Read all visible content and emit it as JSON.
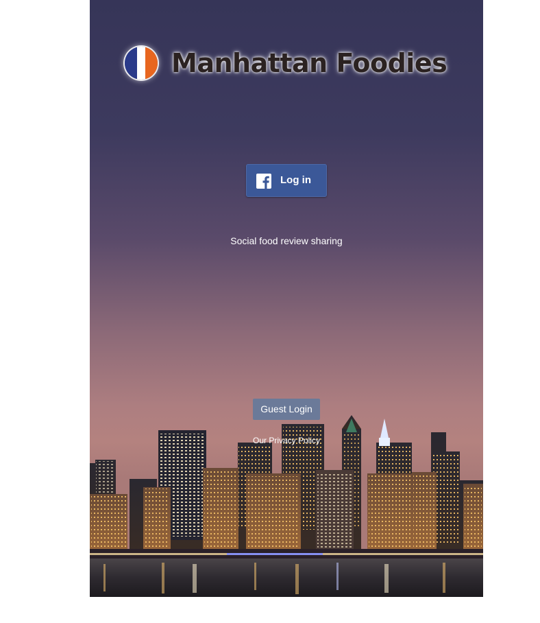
{
  "app": {
    "title": "Manhattan Foodies",
    "tagline": "Social food review sharing",
    "flag_colors": [
      "#2a3a8a",
      "#ffffff",
      "#e8661f"
    ]
  },
  "login": {
    "facebook_label": "Log in",
    "facebook_icon": "facebook-f-icon",
    "facebook_color": "#3b5898",
    "guest_label": "Guest Login",
    "guest_color": "#6b7a99",
    "privacy_label": "Our Privacy Policy"
  },
  "background": {
    "image": "manhattan-skyline-night",
    "sky_top_color": "#363558",
    "sky_horizon_color": "#b4827f"
  }
}
